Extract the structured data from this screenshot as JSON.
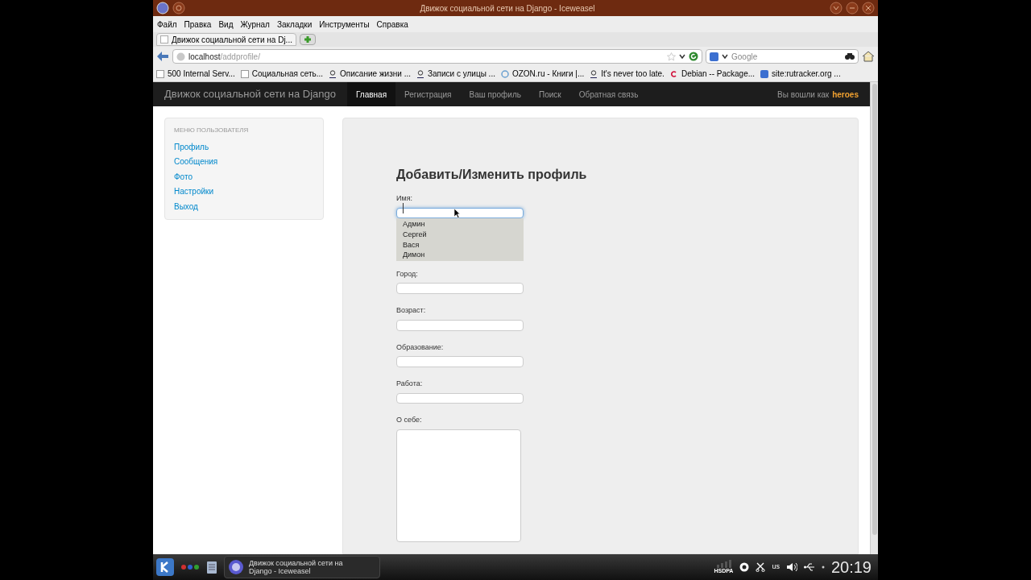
{
  "window": {
    "title": "Движок социальной сети на Django - Iceweasel"
  },
  "menu": [
    "Файл",
    "Правка",
    "Вид",
    "Журнал",
    "Закладки",
    "Инструменты",
    "Справка"
  ],
  "tabs": [
    {
      "label": "Движок социальной сети на Dj...",
      "selected": true
    }
  ],
  "address": {
    "host": "localhost",
    "path": "/addprofile/"
  },
  "search": {
    "placeholder": "Google"
  },
  "bookmarks": [
    "500 Internal Serv...",
    "Социальная сеть...",
    "Описание жизни ...",
    "Записи с улицы ...",
    "OZON.ru - Книги |...",
    "It's never too late.",
    "Debian -- Package...",
    "site:rutracker.org ..."
  ],
  "site_nav": {
    "brand": "Движок социальной сети на Django",
    "links": [
      {
        "label": "Главная",
        "selected": true
      },
      {
        "label": "Регистрация",
        "selected": false
      },
      {
        "label": "Ваш профиль",
        "selected": false
      },
      {
        "label": "Поиск",
        "selected": false
      },
      {
        "label": "Обратная связь",
        "selected": false
      }
    ],
    "login_text": "Вы вошли как",
    "user": "heroes"
  },
  "sidebar": {
    "header": "МЕНЮ ПОЛЬЗОВАТЕЛЯ",
    "items": [
      "Профиль",
      "Сообщения",
      "Фото",
      "Настройки",
      "Выход"
    ]
  },
  "form": {
    "title": "Добавить/Изменить профиль",
    "fields": [
      {
        "label": "Имя:",
        "kind": "input",
        "focused": true,
        "suggestions": [
          "Админ",
          "Сергей",
          "Вася",
          "Димон"
        ]
      },
      {
        "label": "Город:",
        "kind": "input",
        "focused": false
      },
      {
        "label": "Возраст:",
        "kind": "input",
        "focused": false
      },
      {
        "label": "Образование:",
        "kind": "input",
        "focused": false
      },
      {
        "label": "Работа:",
        "kind": "input",
        "focused": false
      },
      {
        "label": "О себе:",
        "kind": "textarea",
        "focused": false
      }
    ]
  },
  "taskbar": {
    "task": "Движок социальной сети на Django - Iceweasel",
    "network": "HSDPA",
    "keyboard": "us",
    "clock": "20:19"
  }
}
